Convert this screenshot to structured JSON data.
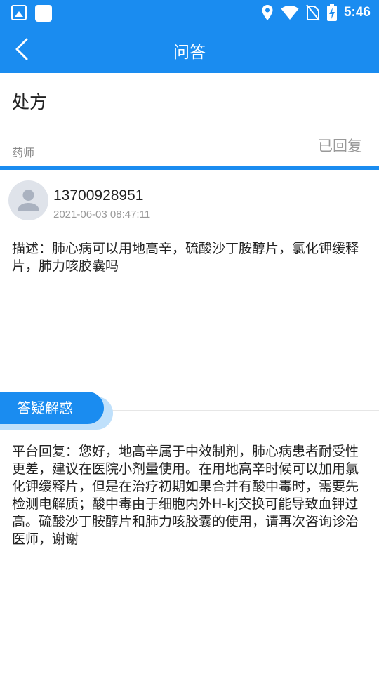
{
  "status_bar": {
    "time": "5:46",
    "icons": [
      "image-icon",
      "app-square-icon",
      "location-icon",
      "wifi-icon",
      "no-sim-icon",
      "battery-charging-icon"
    ]
  },
  "nav": {
    "title": "问答",
    "back_icon": "chevron-left-icon"
  },
  "question": {
    "title": "处方",
    "role": "药师",
    "status": "已回复"
  },
  "asker": {
    "phone": "13700928951",
    "time": "2021-06-03 08:47:11",
    "description": "描述：肺心病可以用地高辛，硫酸沙丁胺醇片，氯化钾缓释片，肺力咳胶囊吗"
  },
  "answer_section": {
    "tag": "答疑解惑",
    "text": "平台回复：您好，地高辛属于中效制剂，肺心病患者耐受性更差，建议在医院小剂量使用。在用地高辛时候可以加用氯化钾缓释片，但是在治疗初期如果合并有酸中毒时，需要先检测电解质；酸中毒由于细胞内外H-kj交换可能导致血钾过高。硫酸沙丁胺醇片和肺力咳胶囊的使用，请再次咨询诊治医师，谢谢"
  },
  "colors": {
    "primary": "#1a8cf0",
    "tag_shadow": "#bfe0fb",
    "muted_text": "#999999"
  }
}
